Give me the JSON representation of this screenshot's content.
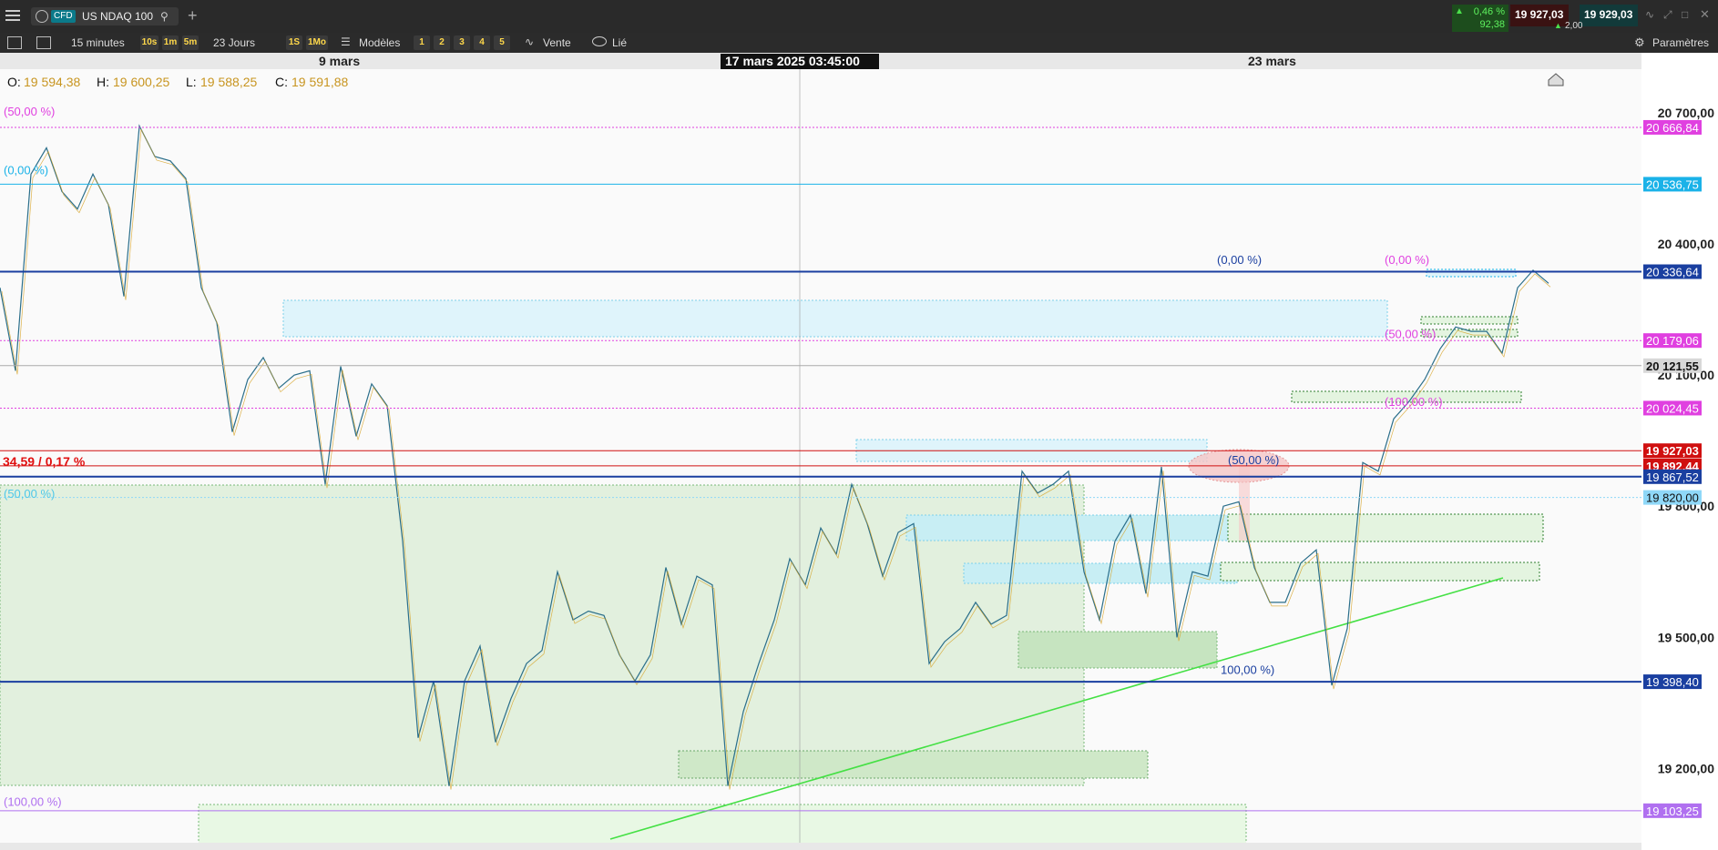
{
  "header": {
    "cfd_badge": "CFD",
    "instrument": "US NDAQ 100",
    "change_pct": "0,46 %",
    "change_pts": "92,38",
    "bid": "19 927,03",
    "ask": "19 929,03",
    "spread": "2,00",
    "add_tab": "+"
  },
  "toolbar": {
    "interval": "15 minutes",
    "tf_buttons": [
      "10s",
      "1m",
      "5m"
    ],
    "period": "23 Jours",
    "tf_buttons2": [
      "1S",
      "1Mo"
    ],
    "models": "Modèles",
    "nums": [
      "1",
      "2",
      "3",
      "4",
      "5"
    ],
    "sell": "Vente",
    "linked": "Lié",
    "settings": "Paramètres"
  },
  "colors": {
    "accent": "#ffd84a",
    "price_label_cyan": "#1ab2e8",
    "price_label_magenta": "#e040e0",
    "price_label_navy": "#1a3fa0",
    "current_price_red": "#d01010"
  },
  "chart_data": {
    "type": "line",
    "date_labels": [
      "9 mars",
      "23 mars"
    ],
    "crosshair_date": "17 mars 2025 03:45:00",
    "ohlc": {
      "o_label": "O:",
      "o": "19 594,38",
      "h_label": "H:",
      "h": "19 600,25",
      "l_label": "L:",
      "l": "19 588,25",
      "c_label": "C:",
      "c": "19 591,88"
    },
    "ylim": [
      19030,
      20800
    ],
    "y_ticks": [
      {
        "value": 20700,
        "label": "20 700,00"
      },
      {
        "value": 20400,
        "label": "20 400,00"
      },
      {
        "value": 20100,
        "label": "20 100,00"
      },
      {
        "value": 19800,
        "label": "19 800,00"
      },
      {
        "value": 19500,
        "label": "19 500,00"
      },
      {
        "value": 19200,
        "label": "19 200,00"
      }
    ],
    "price_labels": [
      {
        "value": 20666.84,
        "label": "20 666,84",
        "color": "#e040e0"
      },
      {
        "value": 20536.75,
        "label": "20 536,75",
        "color": "#1ab2e8"
      },
      {
        "value": 20336.64,
        "label": "20 336,64",
        "color": "#1a3fa0"
      },
      {
        "value": 20179.06,
        "label": "20 179,06",
        "color": "#e040e0"
      },
      {
        "value": 20121.55,
        "label": "20 121,55",
        "color": "#d8d8d8"
      },
      {
        "value": 20024.45,
        "label": "20 024,45",
        "color": "#e040e0"
      },
      {
        "value": 19927.03,
        "label": "19 927,03",
        "color": "#d01010"
      },
      {
        "value": 19892.44,
        "label": "19 892,44",
        "color": "#d01010"
      },
      {
        "value": 19867.52,
        "label": "19 867,52",
        "color": "#1a3fa0"
      },
      {
        "value": 19820.0,
        "label": "19 820,00",
        "color": "#8fd8f8"
      },
      {
        "value": 19398.4,
        "label": "19 398,40",
        "color": "#1a3fa0"
      },
      {
        "value": 19103.25,
        "label": "19 103,25",
        "color": "#b070f0"
      }
    ],
    "fib_labels": [
      {
        "text": "(50,00 %)",
        "value": 20690,
        "color": "#e040e0"
      },
      {
        "text": "(0,00 %)",
        "value": 20555,
        "color": "#1ab2e8"
      },
      {
        "text": "(50,00 %)",
        "value": 19815,
        "color": "#4fc8e8"
      },
      {
        "text": "(100,00 %)",
        "value": 19110,
        "color": "#b070f0"
      },
      {
        "text": "(0,00 %)",
        "value": 20350,
        "color": "#1a3fa0"
      },
      {
        "text": "(0,00 %)",
        "value": 20350,
        "color": "#e040e0"
      },
      {
        "text": "(50,00 %)",
        "value": 20180,
        "color": "#e040e0"
      },
      {
        "text": "(100,00 %)",
        "value": 20025,
        "color": "#e040e0"
      },
      {
        "text": "(50,00 %)",
        "value": 19892,
        "color": "#1a3fa0"
      },
      {
        "text": "100,00 %)",
        "value": 19412,
        "color": "#1a3fa0"
      }
    ],
    "change_label": "34,59 / 0,17 %",
    "series": [
      {
        "x": [
          0,
          10,
          20,
          30,
          40,
          50,
          60,
          70,
          80,
          90,
          100,
          110,
          120,
          130,
          140,
          150,
          160,
          170,
          180,
          190,
          200,
          210,
          220,
          230,
          240,
          250,
          260,
          270,
          280,
          290,
          300,
          310,
          320,
          330,
          340,
          350,
          360,
          370,
          380,
          390,
          400,
          410,
          420,
          430,
          440,
          450,
          460,
          470,
          480,
          490,
          500,
          510,
          520,
          530,
          540,
          550,
          560,
          570,
          580,
          590,
          600,
          610,
          620,
          630,
          640,
          650,
          660,
          670,
          680,
          690,
          700,
          710,
          720,
          730,
          740,
          750,
          760,
          770,
          780,
          790,
          800,
          810,
          820,
          830,
          840,
          850,
          860,
          870,
          880,
          890,
          900,
          910,
          920,
          930,
          940,
          950,
          960,
          970,
          980,
          990,
          1000
        ],
        "y": [
          20300,
          20110,
          20560,
          20620,
          20520,
          20480,
          20560,
          20490,
          20280,
          20670,
          20600,
          20590,
          20550,
          20300,
          20220,
          19970,
          20090,
          20140,
          20070,
          20100,
          20110,
          19850,
          20120,
          19960,
          20080,
          20030,
          19720,
          19270,
          19400,
          19160,
          19400,
          19480,
          19260,
          19360,
          19440,
          19470,
          19650,
          19540,
          19560,
          19550,
          19460,
          19400,
          19460,
          19660,
          19530,
          19640,
          19620,
          19160,
          19330,
          19440,
          19540,
          19680,
          19620,
          19750,
          19690,
          19850,
          19760,
          19640,
          19740,
          19760,
          19440,
          19490,
          19520,
          19580,
          19530,
          19550,
          19880,
          19830,
          19850,
          19880,
          19650,
          19540,
          19720,
          19780,
          19600,
          19890,
          19500,
          19650,
          19640,
          19800,
          19810,
          19660,
          19580,
          19580,
          19670,
          19700,
          19390,
          19520,
          19900,
          19880,
          20000,
          20040,
          20090,
          20160,
          20210,
          20200,
          20200,
          20150,
          20300,
          20340,
          20310
        ]
      }
    ]
  }
}
